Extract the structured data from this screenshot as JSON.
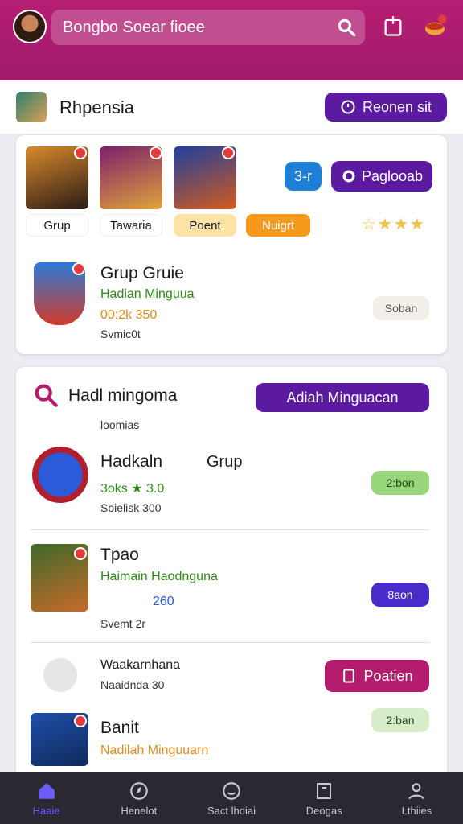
{
  "header": {
    "search_text": "Bongbo Soear fioee"
  },
  "section": {
    "title": "Rhpensia",
    "button": "Reonen sit"
  },
  "featured": {
    "tags": [
      "Grup",
      "Tawaria",
      "Poent",
      "Nuigrt"
    ],
    "pill_small": "3-r",
    "pill_large": "Paglooab",
    "item": {
      "title": "Grup Gruie",
      "subtitle": "Hadian Minguua",
      "stats": "00:2k 350",
      "meta": "Svmic0t",
      "chip": "Soban"
    }
  },
  "list": {
    "title": "Hadl mingoma",
    "button": "Adiah Minguacan",
    "caption": "loomias",
    "items": [
      {
        "title": "Hadkaln",
        "title_extra": "Grup",
        "subtitle": "3oks ★ 3.0",
        "meta": "Soielisk 300",
        "chip": "2:bon"
      },
      {
        "title": "Tpao",
        "title_extra": "",
        "subtitle": "Haimain Haodnguna",
        "stats": "260",
        "meta": "Svemt 2r",
        "chip": "8aon"
      },
      {
        "title": "Waakarnhana",
        "subtitle": "Naaidnda 30",
        "chip": "Poatien"
      },
      {
        "title": "Banit",
        "subtitle": "Nadilah Minguuarn",
        "chip": "2:ban"
      }
    ]
  },
  "nav": [
    {
      "label": "Haaie"
    },
    {
      "label": "Henelot"
    },
    {
      "label": "Sact lhdiai"
    },
    {
      "label": "Deogas"
    },
    {
      "label": "Lthiies"
    }
  ]
}
